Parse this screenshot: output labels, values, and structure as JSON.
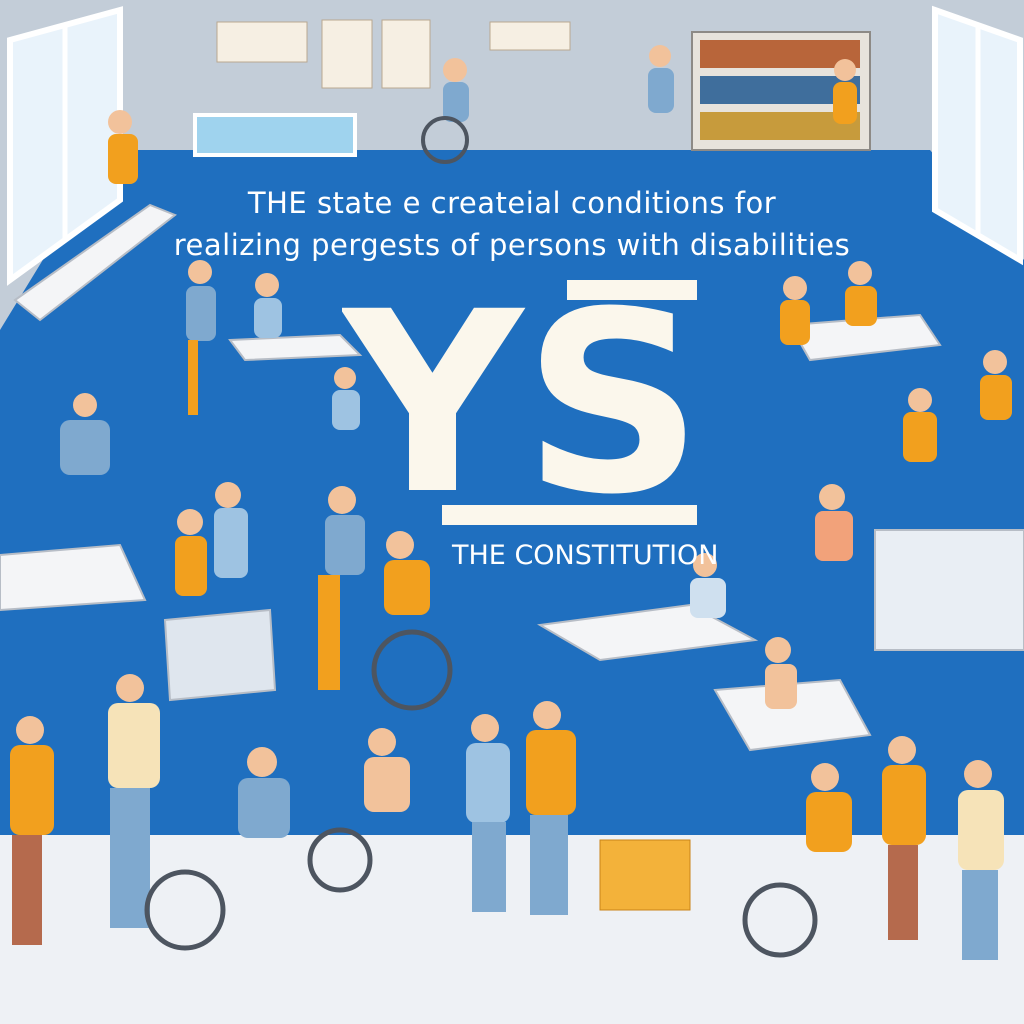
{
  "headline": {
    "line1": "THE state e createial conditions       for",
    "line2": "realizing pergests of persons with disabilities"
  },
  "emblem": {
    "text": "YS"
  },
  "subtitle": "THE CONSTITUTION",
  "colors": {
    "floor_blue": "#1f6fbf",
    "wall": "#c9d2dc",
    "accent_orange": "#f2a01e",
    "shirt_blue": "#7fa9cf",
    "text": "#ffffff"
  }
}
